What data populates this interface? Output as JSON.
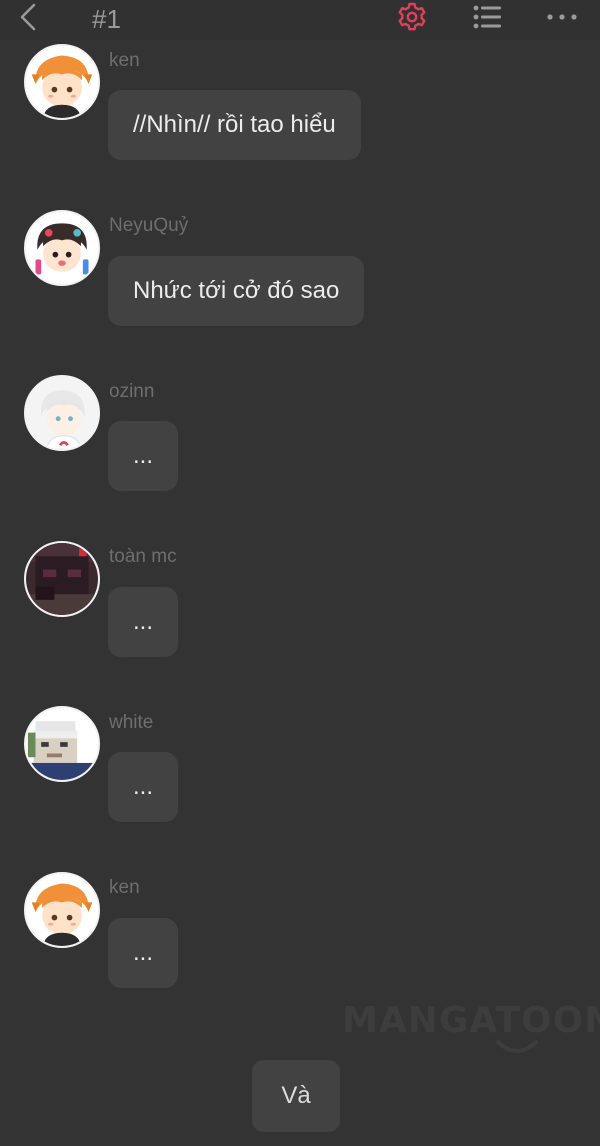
{
  "header": {
    "title": "#1",
    "icons": {
      "back": "chevron-left-icon",
      "settings": "gear-icon",
      "list": "list-icon",
      "more": "more-dots-icon"
    },
    "accent_color": "#e0405a"
  },
  "messages": [
    {
      "user": "ken",
      "text": "//Nhìn// rồi tao hiểu",
      "avatar": "ken-avatar"
    },
    {
      "user": "NeyuQuỷ",
      "text": "Nhức tới cở đó sao",
      "avatar": "neyuquy-avatar"
    },
    {
      "user": "ozinn",
      "text": "...",
      "avatar": "ozinn-avatar"
    },
    {
      "user": "toàn mc",
      "text": "...",
      "avatar": "toan-mc-avatar"
    },
    {
      "user": "white",
      "text": "...",
      "avatar": "white-avatar"
    },
    {
      "user": "ken",
      "text": "...",
      "avatar": "ken-avatar"
    }
  ],
  "watermark": "MANGATOON",
  "continue_button": "Và"
}
